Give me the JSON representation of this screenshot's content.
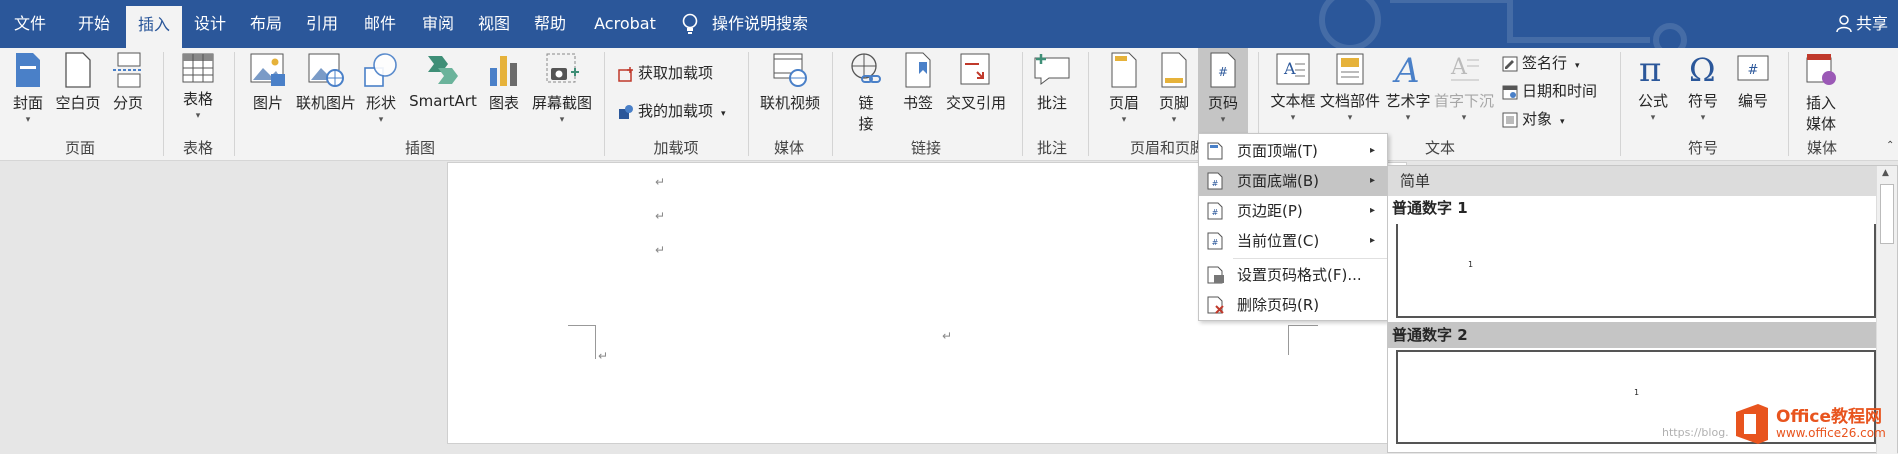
{
  "tabs": [
    "文件",
    "开始",
    "插入",
    "设计",
    "布局",
    "引用",
    "邮件",
    "审阅",
    "视图",
    "帮助",
    "Acrobat",
    "操作说明搜索"
  ],
  "share_label": "共享",
  "ribbon": {
    "pages": {
      "cover": "封面",
      "blank": "空白页",
      "break": "分页",
      "group": "页面"
    },
    "table": {
      "table": "表格",
      "group": "表格"
    },
    "illus": {
      "picture": "图片",
      "online_picture": "联机图片",
      "shapes": "形状",
      "smartart": "SmartArt",
      "chart": "图表",
      "screenshot": "屏幕截图",
      "group": "插图"
    },
    "addins": {
      "get": "获取加载项",
      "my": "我的加载项",
      "group": "加载项"
    },
    "media": {
      "online_video": "联机视频",
      "group": "媒体"
    },
    "links": {
      "link_top": "链",
      "link_bottom": "接",
      "bookmark": "书签",
      "crossref": "交叉引用",
      "group": "链接"
    },
    "comments": {
      "comment": "批注",
      "group": "批注"
    },
    "headerfooter": {
      "header": "页眉",
      "footer": "页脚",
      "pagenum": "页码",
      "group": "页眉和页脚"
    },
    "text": {
      "textbox": "文本框",
      "quickparts": "文档部件",
      "wordart": "艺术字",
      "dropcap": "首字下沉",
      "signature": "签名行",
      "datetime": "日期和时间",
      "object": "对象",
      "group": "文本"
    },
    "symbols": {
      "equation": "公式",
      "symbol": "符号",
      "number": "编号",
      "group": "符号"
    },
    "media2": {
      "embed_top": "插入",
      "embed_bottom": "媒体",
      "group": "媒体"
    }
  },
  "menu": {
    "items": [
      {
        "label": "页面顶端(T)",
        "arrow": "▸"
      },
      {
        "label": "页面底端(B)",
        "arrow": "▸"
      },
      {
        "label": "页边距(P)",
        "arrow": "▸"
      },
      {
        "label": "当前位置(C)",
        "arrow": "▸"
      },
      {
        "label": "设置页码格式(F)..."
      },
      {
        "label": "删除页码(R)"
      }
    ]
  },
  "gallery": {
    "header": "简单",
    "items": [
      {
        "title": "普通数字 1",
        "num": "1"
      },
      {
        "title": "普通数字 2",
        "num": "1"
      }
    ]
  },
  "doc": {
    "para_mark": "↵"
  },
  "watermark": {
    "brand": "Office教程网",
    "url": "www.office26.com",
    "blog": "https://blog."
  }
}
